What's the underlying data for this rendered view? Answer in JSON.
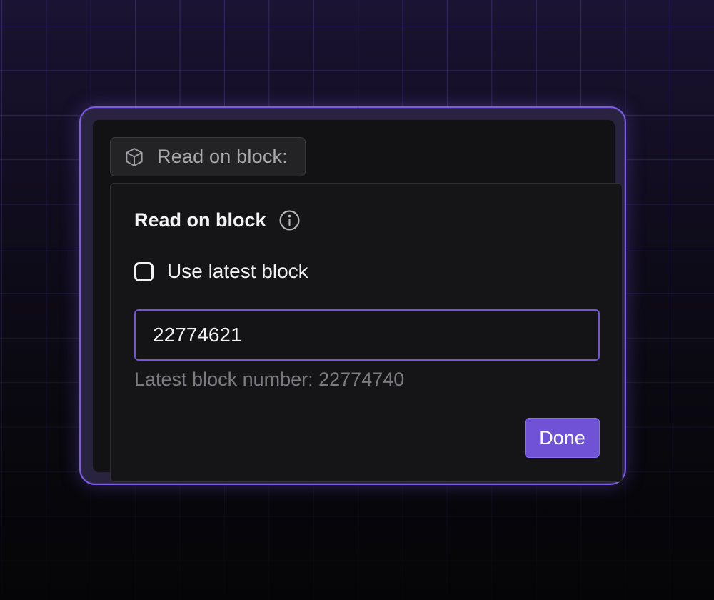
{
  "trigger": {
    "label": "Read on block:",
    "icon": "cube-icon"
  },
  "popover": {
    "title": "Read on block",
    "info_icon": "info-icon",
    "use_latest": {
      "label": "Use latest block",
      "checked": false
    },
    "block_input": {
      "value": "22774621"
    },
    "helper_text": "Latest block number: 22774740",
    "done_label": "Done"
  },
  "colors": {
    "accent": "#6f52d6",
    "panel": "#151517",
    "frame_border": "#7b5ce6"
  }
}
